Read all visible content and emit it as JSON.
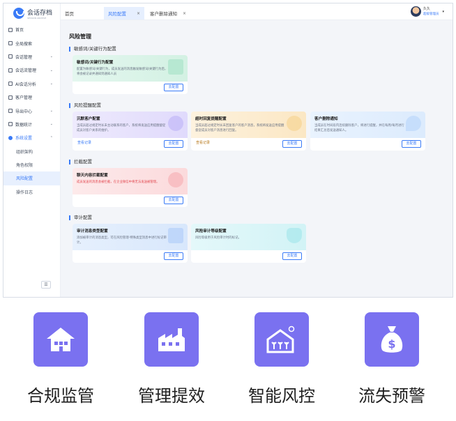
{
  "app": {
    "logo_text": "会话存档",
    "logo_sub": "SESSION ARCHIVE"
  },
  "tabs": [
    {
      "label": "首页"
    },
    {
      "label": "风险配置",
      "close": "×"
    },
    {
      "label": "客户删除通知",
      "close": "×"
    }
  ],
  "user": {
    "name": "久久",
    "role": "超级管理员"
  },
  "sidebar": {
    "items": [
      {
        "label": "首页"
      },
      {
        "label": "全局搜索"
      },
      {
        "label": "会话管理",
        "chevron": "⌄"
      },
      {
        "label": "会话流管理",
        "chevron": "⌄"
      },
      {
        "label": "AI会话分析",
        "chevron": "⌄"
      },
      {
        "label": "客户管理"
      },
      {
        "label": "导出中心",
        "chevron": "⌄"
      },
      {
        "label": "数据统计",
        "chevron": "⌄"
      },
      {
        "label": "系统设置",
        "chevron": "⌃"
      }
    ],
    "sub_items": [
      {
        "label": "组织架构"
      },
      {
        "label": "角色权限"
      },
      {
        "label": "风险配置"
      },
      {
        "label": "操作日志"
      }
    ],
    "collapse": "☰"
  },
  "page": {
    "title": "风险管理",
    "sections": [
      {
        "title": "敏感词/关键行为配置"
      },
      {
        "title": "风险提醒配置"
      },
      {
        "title": "拦截配置"
      },
      {
        "title": "审计配置"
      }
    ]
  },
  "cards": {
    "sensitive": {
      "title": "敏感词/关键行为配置",
      "desc": "配置为敏感词/关键行为，成员发送的消息触发敏感词/关键行为后，将会被记录并通知到通知人员",
      "button": "去配置"
    },
    "silent": {
      "title": "沉默客户配置",
      "desc": "当成员超过规定时长未主动联系的客户，系统将发送应用提醒督促成员对客户关系的维护。",
      "button": "去配置",
      "link": "查看记录"
    },
    "timeout": {
      "title": "超时回复提醒配置",
      "desc": "当成员超过规定时长未回复客户的客户消息，系统将发送应用提醒督促成员对客户消息进行回复。",
      "button": "去配置",
      "link": "查看记录"
    },
    "delete_notice": {
      "title": "客户删除通知",
      "desc": "当成员在时间段内连续删除客户，将进行提醒，并在每周/每月进行结果汇总后发送通知人。",
      "button": "去配置"
    },
    "intercept": {
      "title": "聊天内容拦截配置",
      "desc": "成员发送的消息会被拦截，在企业微信中将无法发送被管理。",
      "button": "去配置"
    },
    "audit_type": {
      "title": "审计消息类型配置",
      "desc": "添加被审计的消息类型，可在风险管理-特殊类型消息中进行标记审计。",
      "button": "去配置"
    },
    "audit_level": {
      "title": "风险审计等级配置",
      "desc": "风险等级用于风险审计时的标记。",
      "button": "去配置"
    }
  },
  "features": [
    {
      "label": "合规监管",
      "icon": "house-icon"
    },
    {
      "label": "管理提效",
      "icon": "factory-icon"
    },
    {
      "label": "智能风控",
      "icon": "greenhouse-icon"
    },
    {
      "label": "流失预警",
      "icon": "money-bag-icon"
    }
  ],
  "colors": {
    "accent": "#3a7bf7",
    "feature_tile": "#7a71f0"
  }
}
